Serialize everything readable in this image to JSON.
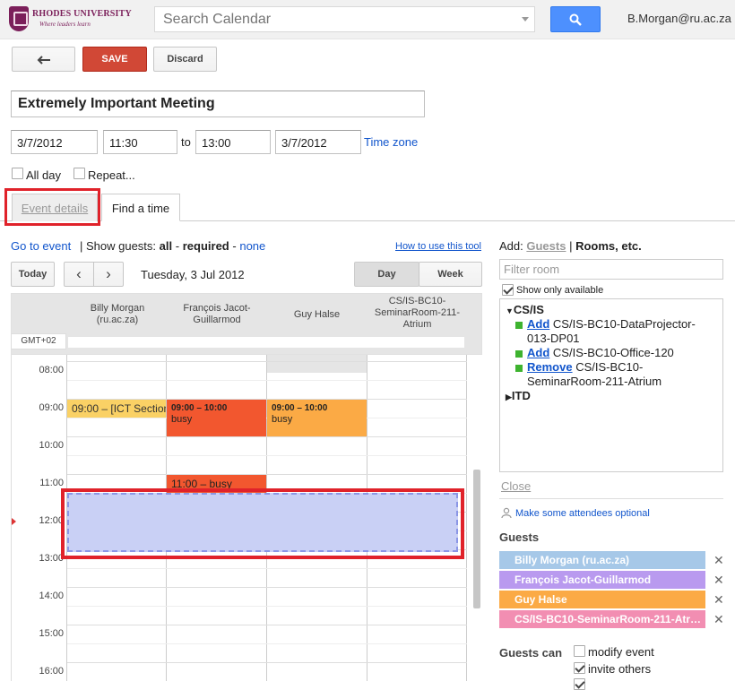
{
  "header": {
    "logo_name": "RHODES UNIVERSITY",
    "logo_tagline": "Where leaders learn",
    "search_placeholder": "Search Calendar",
    "user": "B.Morgan@ru.ac.za"
  },
  "toolbar": {
    "save_label": "SAVE",
    "discard_label": "Discard"
  },
  "event": {
    "title": "Extremely Important Meeting",
    "start_date": "3/7/2012",
    "start_time": "11:30",
    "to_label": "to",
    "end_time": "13:00",
    "end_date": "3/7/2012",
    "timezone_label": "Time zone",
    "allday_label": "All day",
    "repeat_label": "Repeat..."
  },
  "tabs": [
    {
      "label": "Event details",
      "active": false
    },
    {
      "label": "Find a time",
      "active": true
    }
  ],
  "finder": {
    "goto_event": "Go to event",
    "show_guests_prefix": "| Show guests:",
    "show_all": "all",
    "show_dash": "-",
    "show_required": "required",
    "show_none": "none",
    "how_to": "How to use this tool",
    "today_label": "Today",
    "date_label": "Tuesday, 3 Jul 2012",
    "day_label": "Day",
    "week_label": "Week",
    "timezone": "GMT+02",
    "columns": [
      {
        "line1": "Billy Morgan",
        "line2": "(ru.ac.za)",
        "line3": ""
      },
      {
        "line1": "François Jacot-",
        "line2": "Guillarmod",
        "line3": ""
      },
      {
        "line1": "Guy Halse",
        "line2": "",
        "line3": ""
      },
      {
        "line1": "CS/IS-BC10-",
        "line2": "SeminarRoom-211-",
        "line3": "Atrium"
      }
    ],
    "hours": [
      "08:00",
      "09:00",
      "10:00",
      "11:00",
      "12:00",
      "13:00",
      "14:00",
      "15:00",
      "16:00"
    ],
    "events": [
      {
        "text": "09:00 – [ICT Section",
        "sub": ""
      },
      {
        "text": "09:00 – 10:00",
        "sub": "busy"
      },
      {
        "text": "09:00 – 10:00",
        "sub": "busy"
      },
      {
        "text": "11:00 – busy",
        "sub": ""
      }
    ]
  },
  "rooms": {
    "add_label": "Add:",
    "guests_tab": "Guests",
    "sep": "|",
    "rooms_tab": "Rooms, etc.",
    "filter_placeholder": "Filter room",
    "only_available": "Show only available",
    "group1": "CS/IS",
    "items": [
      {
        "action": "Add",
        "name1": "CS/IS-BC10-DataProjector-",
        "name2": "013-DP01"
      },
      {
        "action": "Add",
        "name1": "CS/IS-BC10-Office-120",
        "name2": ""
      },
      {
        "action": "Remove",
        "name1": "CS/IS-BC10-",
        "name2": "SeminarRoom-211-Atrium"
      }
    ],
    "group2": "ITD",
    "close_label": "Close",
    "optional_label": "Make some attendees optional"
  },
  "guests": {
    "title": "Guests",
    "list": [
      {
        "name": "Billy Morgan (ru.ac.za)",
        "color": "#a6c8e8"
      },
      {
        "name": "François Jacot-Guillarmod",
        "color": "#b99aef"
      },
      {
        "name": "Guy Halse",
        "color": "#fbaa45"
      },
      {
        "name": "CS/IS-BC10-SeminarRoom-211-Atr…",
        "color": "#f28eb2"
      }
    ],
    "remove_glyph": "✕",
    "can_label": "Guests can",
    "perm_modify": "modify event",
    "perm_invite": "invite others"
  },
  "colors": {
    "save": "#d14836",
    "link": "#1155cc",
    "selection": "#c9d0f5",
    "highlight": "#e0222a"
  }
}
